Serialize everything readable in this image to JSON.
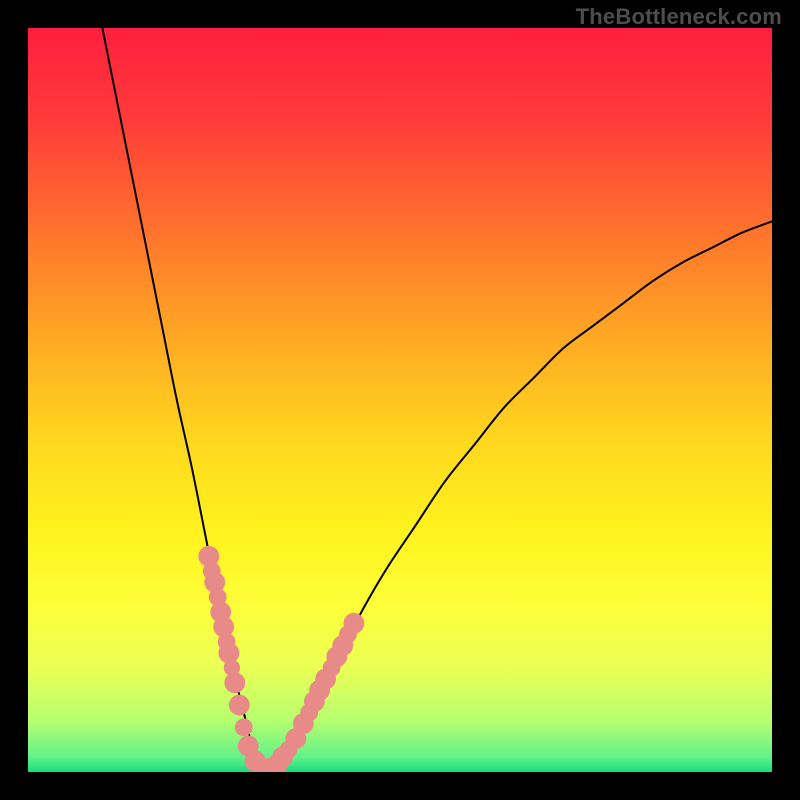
{
  "watermark": "TheBottleneck.com",
  "chart_data": {
    "type": "line",
    "title": "",
    "xlabel": "",
    "ylabel": "",
    "xlim": [
      0,
      100
    ],
    "ylim": [
      0,
      100
    ],
    "grid": false,
    "series": [
      {
        "name": "curve",
        "x": [
          10,
          12,
          14,
          16,
          18,
          20,
          22,
          24,
          25,
          26,
          27,
          28,
          29,
          30,
          31,
          32,
          33,
          34,
          36,
          38,
          40,
          44,
          48,
          52,
          56,
          60,
          64,
          68,
          72,
          76,
          80,
          84,
          88,
          92,
          96,
          100
        ],
        "y": [
          100,
          90,
          80,
          70,
          60,
          50,
          41,
          31,
          26,
          22,
          17,
          12,
          8,
          4,
          2,
          0.5,
          0.5,
          1.5,
          4,
          8,
          12,
          20,
          27,
          33,
          39,
          44,
          49,
          53,
          57,
          60,
          63,
          66,
          68.5,
          70.5,
          72.5,
          74
        ]
      }
    ],
    "markers": {
      "name": "salmon-dots",
      "color": "#e88a87",
      "points": [
        {
          "x": 24.3,
          "y": 29.0,
          "r": 1.4
        },
        {
          "x": 24.7,
          "y": 27.0,
          "r": 1.2
        },
        {
          "x": 25.1,
          "y": 25.5,
          "r": 1.4
        },
        {
          "x": 25.5,
          "y": 23.5,
          "r": 1.2
        },
        {
          "x": 25.9,
          "y": 21.5,
          "r": 1.4
        },
        {
          "x": 26.3,
          "y": 19.5,
          "r": 1.4
        },
        {
          "x": 26.7,
          "y": 17.5,
          "r": 1.2
        },
        {
          "x": 27.0,
          "y": 16.0,
          "r": 1.4
        },
        {
          "x": 27.4,
          "y": 14.0,
          "r": 1.1
        },
        {
          "x": 27.8,
          "y": 12.0,
          "r": 1.4
        },
        {
          "x": 28.4,
          "y": 9.0,
          "r": 1.4
        },
        {
          "x": 29.0,
          "y": 6.0,
          "r": 1.2
        },
        {
          "x": 29.6,
          "y": 3.5,
          "r": 1.4
        },
        {
          "x": 30.5,
          "y": 1.5,
          "r": 1.4
        },
        {
          "x": 31.5,
          "y": 0.5,
          "r": 1.4
        },
        {
          "x": 32.5,
          "y": 0.5,
          "r": 1.4
        },
        {
          "x": 33.5,
          "y": 1.0,
          "r": 1.4
        },
        {
          "x": 34.2,
          "y": 2.0,
          "r": 1.4
        },
        {
          "x": 35.0,
          "y": 3.0,
          "r": 1.2
        },
        {
          "x": 36.0,
          "y": 4.5,
          "r": 1.4
        },
        {
          "x": 37.0,
          "y": 6.5,
          "r": 1.4
        },
        {
          "x": 37.8,
          "y": 8.0,
          "r": 1.2
        },
        {
          "x": 38.5,
          "y": 9.5,
          "r": 1.4
        },
        {
          "x": 39.2,
          "y": 11.0,
          "r": 1.4
        },
        {
          "x": 40.0,
          "y": 12.5,
          "r": 1.4
        },
        {
          "x": 40.8,
          "y": 14.0,
          "r": 1.2
        },
        {
          "x": 41.5,
          "y": 15.5,
          "r": 1.4
        },
        {
          "x": 42.3,
          "y": 17.0,
          "r": 1.4
        },
        {
          "x": 43.0,
          "y": 18.5,
          "r": 1.2
        },
        {
          "x": 43.8,
          "y": 20.0,
          "r": 1.4
        }
      ]
    },
    "gradient_stops": [
      {
        "offset": 0.0,
        "color": "#ff1f3e"
      },
      {
        "offset": 0.12,
        "color": "#ff3a3a"
      },
      {
        "offset": 0.25,
        "color": "#ff6a2e"
      },
      {
        "offset": 0.4,
        "color": "#ffa324"
      },
      {
        "offset": 0.55,
        "color": "#ffd61e"
      },
      {
        "offset": 0.68,
        "color": "#fff31e"
      },
      {
        "offset": 0.78,
        "color": "#fdff3a"
      },
      {
        "offset": 0.86,
        "color": "#eaff55"
      },
      {
        "offset": 0.93,
        "color": "#b7ff6e"
      },
      {
        "offset": 0.98,
        "color": "#63f28a"
      },
      {
        "offset": 1.0,
        "color": "#17dc7c"
      }
    ]
  }
}
